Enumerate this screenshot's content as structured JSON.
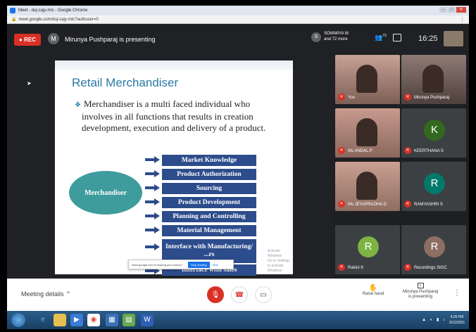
{
  "browser": {
    "window_title": "Meet - duj-cajy-mic - Google Chrome",
    "url": "meet.google.com/duj-cajy-mic?authuser=0"
  },
  "meet": {
    "rec_label": "REC",
    "presenter_initial": "M",
    "presenter_text": "Mirunya Pushparaj is presenting",
    "participants_initial": "S",
    "participants_line1": "SOWMIYA M",
    "participants_line2": "and 72 more",
    "people_count": "73",
    "time": "16:25"
  },
  "slide": {
    "title": "Retail Merchandiser",
    "bullet": "Merchandiser is a multi faced individual who involves in all functions that results in creation development, execution and delivery of a product.",
    "center_label": "Merchandiser",
    "functions": [
      "Market Knowledge",
      "Product Authorization",
      "Sourcing",
      "Product Development",
      "Planning and Controlling",
      "Material Management",
      "Interface with Manufacturing/ ...rs",
      "Interface with sales"
    ],
    "share_notice": "meet.google.com is sharing your screen.",
    "stop_sharing": "Stop sharing",
    "hide": "Hide",
    "activate_line1": "Activate Windows",
    "activate_line2": "Go to Settings to activate Windows."
  },
  "participants": [
    {
      "name": "You",
      "type": "video",
      "color": "#8a6d60"
    },
    {
      "name": "Mirunya Pushparaj",
      "type": "video",
      "color": "#6f5a52"
    },
    {
      "name": "Ms ANDAL P",
      "type": "video",
      "color": "#9a7e70"
    },
    {
      "name": "KEERTHANA S",
      "type": "avatar",
      "initial": "K",
      "color": "#33691e"
    },
    {
      "name": "Ms JEYAPRADHA D",
      "type": "video",
      "color": "#a08576"
    },
    {
      "name": "RAMYASHRI S",
      "type": "avatar",
      "initial": "R",
      "color": "#00796b"
    },
    {
      "name": "Rakini K",
      "type": "avatar",
      "initial": "R",
      "color": "#7cb342"
    },
    {
      "name": "Recordings SIGC",
      "type": "avatar",
      "initial": "R",
      "color": "#8d6e63"
    }
  ],
  "bottom": {
    "meeting_details": "Meeting details",
    "raise_hand": "Raise hand",
    "present_line1": "Mirunya Pushparaj",
    "present_line2": "is presenting"
  },
  "taskbar": {
    "time": "4:25 PM",
    "date": "3/12/2021"
  }
}
